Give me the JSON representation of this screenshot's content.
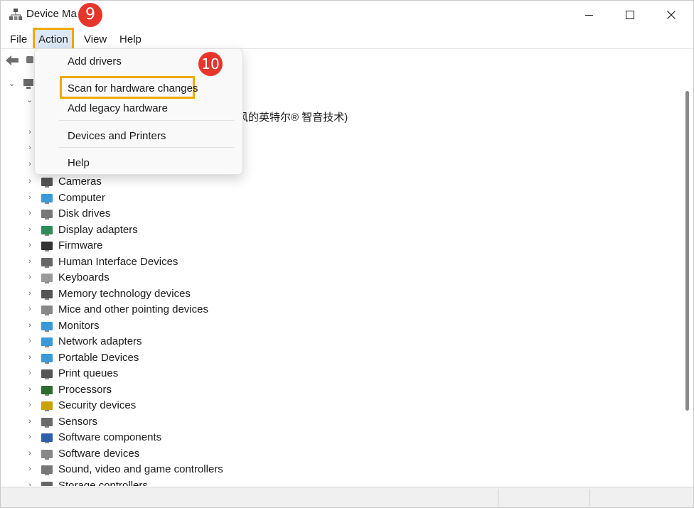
{
  "window": {
    "title": "Device Ma",
    "minimize": "minimize",
    "maximize": "maximize",
    "close": "close"
  },
  "menubar": {
    "file": "File",
    "action": "Action",
    "view": "View",
    "help": "Help"
  },
  "action_menu": {
    "items": [
      "Add drivers",
      "Scan for hardware changes",
      "Add legacy hardware",
      "Devices and Printers",
      "Help"
    ],
    "highlighted": "Scan for hardware changes"
  },
  "badges": {
    "step9": "9",
    "step10": "10"
  },
  "tree": {
    "partial_text": "风的英特尔® 智音技术)",
    "categories": [
      {
        "label": "Cameras",
        "icon": "camera-icon"
      },
      {
        "label": "Computer",
        "icon": "computer-icon"
      },
      {
        "label": "Disk drives",
        "icon": "disk-drive-icon"
      },
      {
        "label": "Display adapters",
        "icon": "display-adapter-icon"
      },
      {
        "label": "Firmware",
        "icon": "firmware-icon"
      },
      {
        "label": "Human Interface Devices",
        "icon": "hid-icon"
      },
      {
        "label": "Keyboards",
        "icon": "keyboard-icon"
      },
      {
        "label": "Memory technology devices",
        "icon": "memory-icon"
      },
      {
        "label": "Mice and other pointing devices",
        "icon": "mouse-icon"
      },
      {
        "label": "Monitors",
        "icon": "monitor-icon"
      },
      {
        "label": "Network adapters",
        "icon": "network-icon"
      },
      {
        "label": "Portable Devices",
        "icon": "portable-device-icon"
      },
      {
        "label": "Print queues",
        "icon": "printer-icon"
      },
      {
        "label": "Processors",
        "icon": "processor-icon"
      },
      {
        "label": "Security devices",
        "icon": "security-icon"
      },
      {
        "label": "Sensors",
        "icon": "sensor-icon"
      },
      {
        "label": "Software components",
        "icon": "software-component-icon"
      },
      {
        "label": "Software devices",
        "icon": "software-device-icon"
      },
      {
        "label": "Sound, video and game controllers",
        "icon": "sound-icon"
      },
      {
        "label": "Storage controllers",
        "icon": "storage-icon"
      }
    ]
  },
  "colors": {
    "highlight_border": "#f0a800",
    "badge": "#e8352b",
    "menu_selected": "#dbe8f6"
  }
}
